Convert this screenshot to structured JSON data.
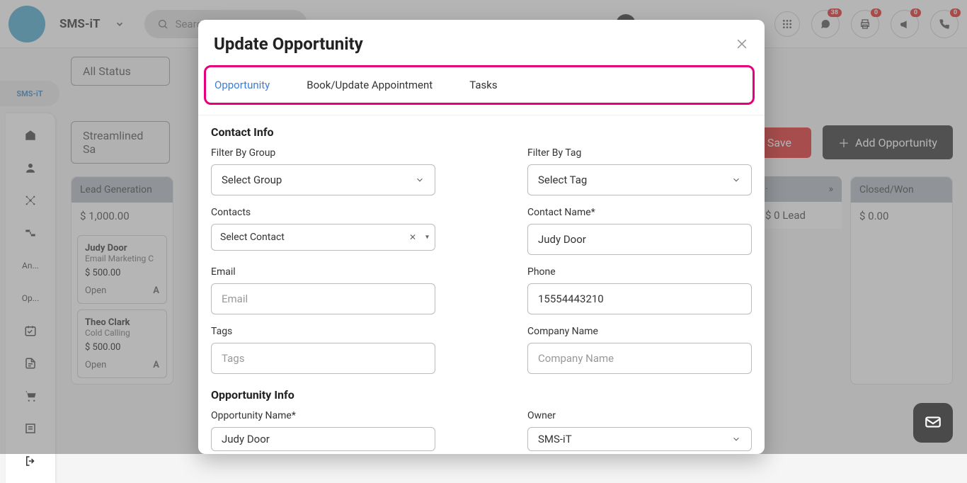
{
  "brand": {
    "name": "SMS-iT"
  },
  "search": {
    "placeholder": "Search"
  },
  "header_badges": {
    "chat": "38",
    "printer": "0",
    "megaphone": "0",
    "phone": "0"
  },
  "sidebar": {
    "logo_text": "SMS-iT",
    "items": [
      "An...",
      "Op..."
    ]
  },
  "status_filter": {
    "label": "All Status"
  },
  "pipeline": {
    "name": "Streamlined Sa"
  },
  "buttons": {
    "save": "Save",
    "add_opportunity": "Add Opportunity"
  },
  "kanban": {
    "col1": {
      "header": "Lead Generation",
      "total": "$ 1,000.00",
      "cards": [
        {
          "name": "Judy Door",
          "source": "Email Marketing C",
          "amount": "$ 500.00",
          "status": "Open"
        },
        {
          "name": "Theo Clark",
          "source": "Cold Calling",
          "amount": "$ 500.00",
          "status": "Open"
        }
      ]
    },
    "col_lead": {
      "label": "Lead",
      "prev": "$ 0"
    },
    "col_closed": {
      "header": "Closed/Won",
      "total": "$ 0.00"
    }
  },
  "modal": {
    "title": "Update Opportunity",
    "tabs": {
      "opportunity": "Opportunity",
      "appointment": "Book/Update Appointment",
      "tasks": "Tasks"
    },
    "sections": {
      "contact_info": "Contact Info",
      "opportunity_info": "Opportunity Info"
    },
    "fields": {
      "filter_group": {
        "label": "Filter By Group",
        "placeholder": "Select Group"
      },
      "filter_tag": {
        "label": "Filter By Tag",
        "placeholder": "Select Tag"
      },
      "contacts": {
        "label": "Contacts",
        "placeholder": "Select Contact"
      },
      "contact_name": {
        "label": "Contact Name*",
        "value": "Judy Door"
      },
      "email": {
        "label": "Email",
        "placeholder": "Email",
        "value": ""
      },
      "phone": {
        "label": "Phone",
        "value": "15554443210"
      },
      "tags": {
        "label": "Tags",
        "placeholder": "Tags"
      },
      "company": {
        "label": "Company Name",
        "placeholder": "Company Name",
        "value": ""
      },
      "opp_name": {
        "label": "Opportunity Name*",
        "value": "Judy Door"
      },
      "owner": {
        "label": "Owner",
        "value": "SMS-iT"
      }
    }
  }
}
